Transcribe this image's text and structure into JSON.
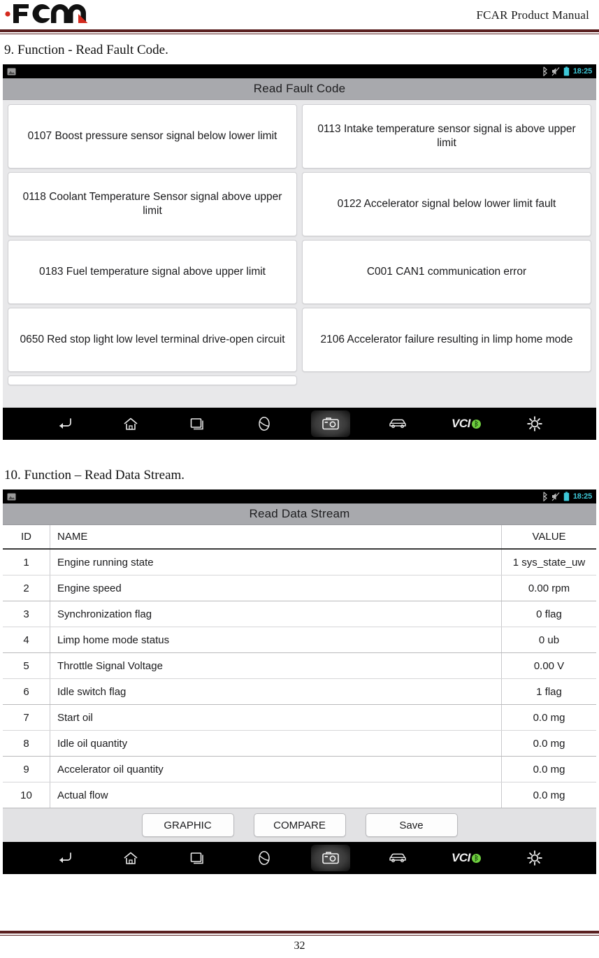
{
  "document": {
    "header_title": "FCAR Product Manual",
    "logo_alt": "FCAR",
    "page_number": "32"
  },
  "sections": [
    {
      "heading": "9. Function - Read Fault Code."
    },
    {
      "heading": "10. Function – Read Data Stream."
    }
  ],
  "statusbar": {
    "time": "18:25",
    "icons": [
      "screenshot-icon",
      "bluetooth-icon",
      "mute-icon",
      "battery-icon"
    ]
  },
  "navbar": {
    "items": [
      {
        "name": "back-icon",
        "label": ""
      },
      {
        "name": "home-icon",
        "label": ""
      },
      {
        "name": "recents-icon",
        "label": ""
      },
      {
        "name": "browser-icon",
        "label": ""
      },
      {
        "name": "camera-icon",
        "label": ""
      },
      {
        "name": "vehicle-icon",
        "label": ""
      },
      {
        "name": "vci-icon",
        "label": "VCI"
      },
      {
        "name": "settings-gear-icon",
        "label": ""
      }
    ],
    "active": "camera-icon"
  },
  "fault_screen": {
    "title": "Read Fault Code",
    "codes": [
      "0107 Boost pressure sensor signal below lower limit",
      "0113 Intake temperature sensor signal is above upper limit",
      "0118 Coolant Temperature Sensor signal above upper limit",
      "0122 Accelerator signal below lower limit fault",
      "0183 Fuel temperature signal above upper limit",
      "C001 CAN1 communication error",
      "0650 Red stop light low level terminal drive-open circuit",
      "2106 Accelerator failure resulting in limp home mode"
    ]
  },
  "datastream_screen": {
    "title": "Read Data Stream",
    "columns": {
      "id": "ID",
      "name": "NAME",
      "value": "VALUE"
    },
    "rows": [
      {
        "id": "1",
        "name": "Engine running state",
        "value": "1 sys_state_uw"
      },
      {
        "id": "2",
        "name": "Engine speed",
        "value": "0.00 rpm"
      },
      {
        "id": "3",
        "name": "Synchronization flag",
        "value": "0 flag"
      },
      {
        "id": "4",
        "name": "Limp home mode status",
        "value": "0 ub"
      },
      {
        "id": "5",
        "name": "Throttle Signal Voltage",
        "value": "0.00 V"
      },
      {
        "id": "6",
        "name": "Idle switch flag",
        "value": "1 flag"
      },
      {
        "id": "7",
        "name": "Start oil",
        "value": "0.0 mg"
      },
      {
        "id": "8",
        "name": "Idle oil quantity",
        "value": "0.0 mg"
      },
      {
        "id": "9",
        "name": "Accelerator oil quantity",
        "value": "0.0 mg"
      },
      {
        "id": "10",
        "name": "Actual flow",
        "value": "0.0 mg"
      }
    ],
    "buttons": [
      {
        "name": "graphic-button",
        "label": "GRAPHIC"
      },
      {
        "name": "compare-button",
        "label": "COMPARE"
      },
      {
        "name": "save-button",
        "label": "Save"
      }
    ]
  },
  "colors": {
    "brand_red": "#d42a1e",
    "rule_maroon": "#5a2020",
    "titlebar_gray": "#a8a9ad",
    "status_teal": "#3ec8d8",
    "vci_green": "#6fcf3f"
  }
}
